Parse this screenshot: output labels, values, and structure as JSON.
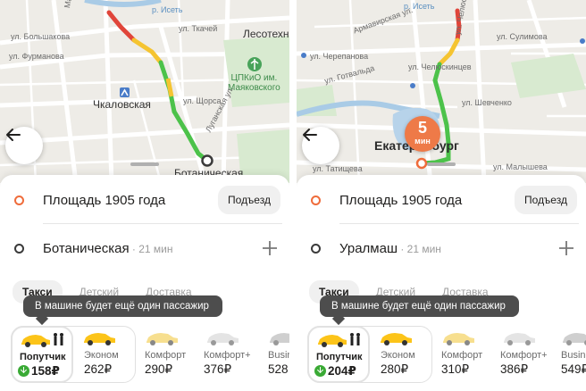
{
  "panels": [
    {
      "map": {
        "labels": {
          "street_1": "ул. Большакова",
          "street_2": "ул. Фурманова",
          "street_3": "ул. Ткачей",
          "street_4": "ул. Щорса",
          "street_5": "Луганская ул.",
          "street_6": "Машинная",
          "district": "Лесотехни",
          "park": "ЦПКиО им.\nМаяковского",
          "metro": "Чкаловская",
          "stop": "Ботаническая",
          "river": "р. Исеть"
        }
      },
      "pickup": {
        "label": "Площадь 1905 года",
        "entrance_button": "Подъезд"
      },
      "destination": {
        "label": "Ботаническая",
        "eta": " · 21 мин"
      },
      "tabs": [
        "Такси",
        "Детский",
        "Доставка"
      ],
      "tooltip": "В машине будет ещё один пассажир",
      "tariffs": [
        {
          "name": "Попутчик",
          "price": "158₽"
        },
        {
          "name": "Эконом",
          "price": "262₽"
        },
        {
          "name": "Комфорт",
          "price": "290₽"
        },
        {
          "name": "Комфорт+",
          "price": "376₽"
        },
        {
          "name": "Business",
          "price": "528"
        }
      ]
    },
    {
      "map": {
        "labels": {
          "street_1": "Армавирская ул.",
          "street_2": "ул. Черепанова",
          "street_3": "ул. Готвальда",
          "street_4": "ул. Челюскинцев",
          "street_5": "ул. Шевченко",
          "street_6": "ул. Татищева",
          "street_7": "ул. Малышева",
          "street_8": "ул. Сулимова",
          "river": "р. Исеть",
          "city": "Екатеринбург"
        },
        "eta_number": "5",
        "eta_unit": "мин"
      },
      "pickup": {
        "label": "Площадь 1905 года",
        "entrance_button": "Подъезд"
      },
      "destination": {
        "label": "Уралмаш",
        "eta": " · 21 мин"
      },
      "tabs": [
        "Такси",
        "Детский",
        "Доставка"
      ],
      "tooltip": "В машине будет ещё один пассажир",
      "tariffs": [
        {
          "name": "Попутчик",
          "price": "204₽"
        },
        {
          "name": "Эконом",
          "price": "280₽"
        },
        {
          "name": "Комфорт",
          "price": "310₽"
        },
        {
          "name": "Комфорт+",
          "price": "386₽"
        },
        {
          "name": "Business",
          "price": "549₽"
        }
      ]
    }
  ],
  "colors": {
    "pickup_dot": "#ef6c3b",
    "route_green": "#4cc24a",
    "route_yellow": "#f5c431",
    "route_red": "#e0453a",
    "taxi_yellow": "#fcc419",
    "discount_green": "#3aaa35",
    "eta_badge": "#ee7a48"
  }
}
